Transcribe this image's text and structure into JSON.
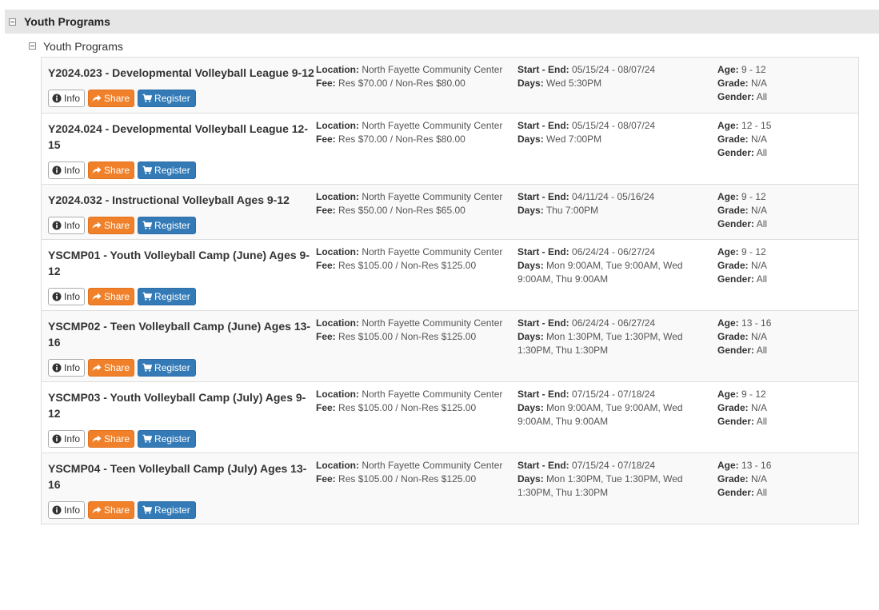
{
  "category": {
    "title": "Youth Programs"
  },
  "subcategory": {
    "title": "Youth Programs"
  },
  "labels": {
    "location": "Location:",
    "fee": "Fee:",
    "start_end": "Start - End:",
    "days": "Days:",
    "age": "Age:",
    "grade": "Grade:",
    "gender": "Gender:",
    "info": "Info",
    "share": "Share",
    "register": "Register"
  },
  "colors": {
    "share": "#f0812a",
    "register": "#337ab7",
    "header_bg": "#e6e6e6"
  },
  "icons": {
    "info": "info-circle-icon",
    "share": "share-arrow-icon",
    "register": "shopping-cart-icon",
    "toggle": "collapse-minus-icon"
  },
  "programs": [
    {
      "name": "Y2024.023 - Developmental Volleyball League 9-12",
      "location": "North Fayette Community Center",
      "fee": "Res $70.00 / Non-Res $80.00",
      "dates": "05/15/24 - 08/07/24",
      "days": "Wed 5:30PM",
      "age": "9 - 12",
      "grade": "N/A",
      "gender": "All"
    },
    {
      "name": "Y2024.024 - Developmental Volleyball League 12-15",
      "location": "North Fayette Community Center",
      "fee": "Res $70.00 / Non-Res $80.00",
      "dates": "05/15/24 - 08/07/24",
      "days": "Wed 7:00PM",
      "age": "12 - 15",
      "grade": "N/A",
      "gender": "All"
    },
    {
      "name": "Y2024.032 - Instructional Volleyball Ages 9-12",
      "location": "North Fayette Community Center",
      "fee": "Res $50.00 / Non-Res $65.00",
      "dates": "04/11/24 - 05/16/24",
      "days": "Thu 7:00PM",
      "age": "9 - 12",
      "grade": "N/A",
      "gender": "All"
    },
    {
      "name": "YSCMP01 - Youth Volleyball Camp (June) Ages 9-12",
      "location": "North Fayette Community Center",
      "fee": "Res $105.00 / Non-Res $125.00",
      "dates": "06/24/24 - 06/27/24",
      "days": "Mon 9:00AM, Tue 9:00AM, Wed 9:00AM, Thu 9:00AM",
      "age": "9 - 12",
      "grade": "N/A",
      "gender": "All"
    },
    {
      "name": "YSCMP02 - Teen Volleyball Camp (June) Ages 13-16",
      "location": "North Fayette Community Center",
      "fee": "Res $105.00 / Non-Res $125.00",
      "dates": "06/24/24 - 06/27/24",
      "days": "Mon 1:30PM, Tue 1:30PM, Wed 1:30PM, Thu 1:30PM",
      "age": "13 - 16",
      "grade": "N/A",
      "gender": "All"
    },
    {
      "name": "YSCMP03 - Youth Volleyball Camp (July) Ages 9-12",
      "location": "North Fayette Community Center",
      "fee": "Res $105.00 / Non-Res $125.00",
      "dates": "07/15/24 - 07/18/24",
      "days": "Mon 9:00AM, Tue 9:00AM, Wed 9:00AM, Thu 9:00AM",
      "age": "9 - 12",
      "grade": "N/A",
      "gender": "All"
    },
    {
      "name": "YSCMP04 - Teen Volleyball Camp (July) Ages 13-16",
      "location": "North Fayette Community Center",
      "fee": "Res $105.00 / Non-Res $125.00",
      "dates": "07/15/24 - 07/18/24",
      "days": "Mon 1:30PM, Tue 1:30PM, Wed 1:30PM, Thu 1:30PM",
      "age": "13 - 16",
      "grade": "N/A",
      "gender": "All"
    }
  ]
}
